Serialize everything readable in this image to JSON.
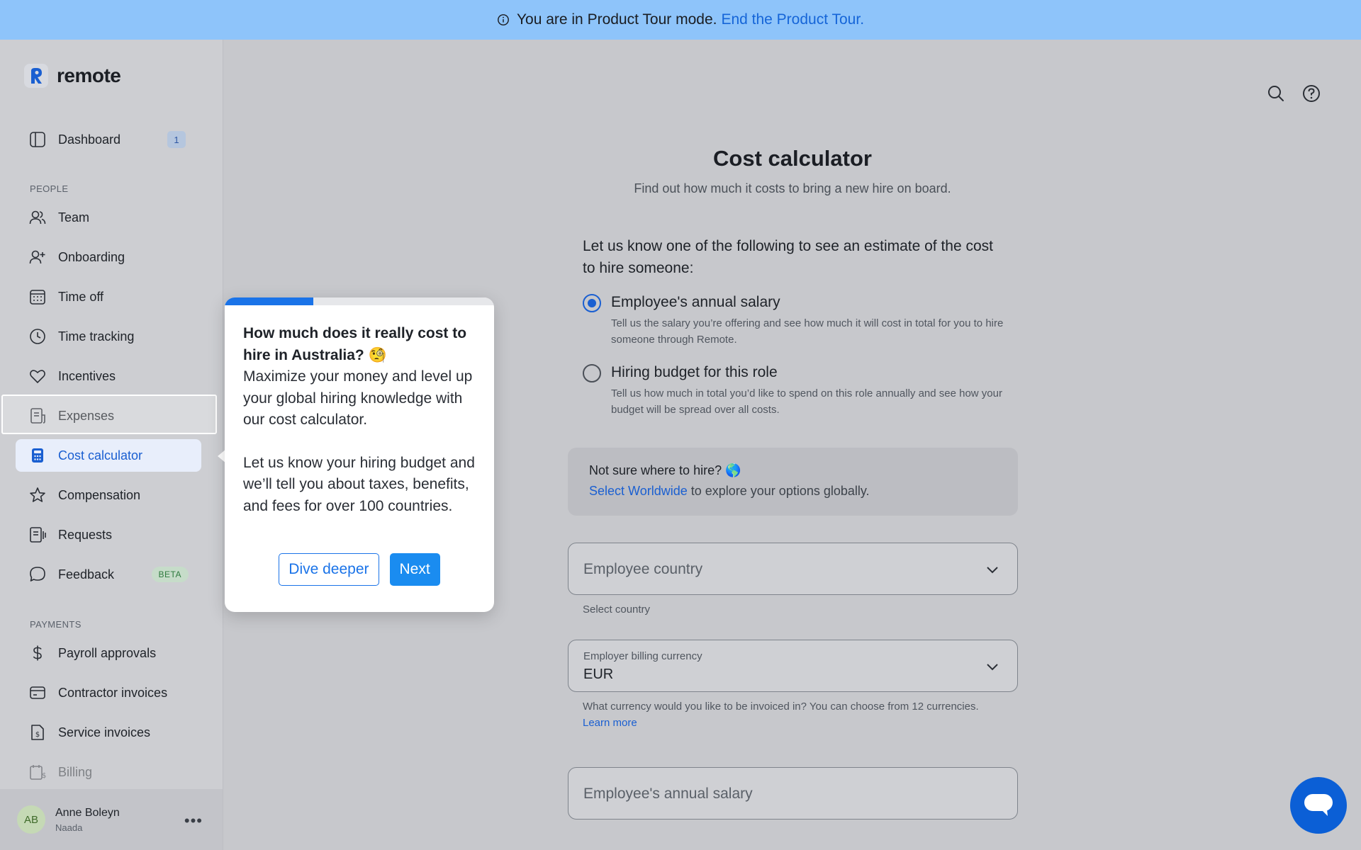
{
  "banner": {
    "text": "You are in Product Tour mode.",
    "link": "End the Product Tour."
  },
  "brand": {
    "name": "remote"
  },
  "sidebar": {
    "dashboard": {
      "label": "Dashboard",
      "badge": "1"
    },
    "people_label": "PEOPLE",
    "people": [
      {
        "label": "Team",
        "icon": "users-icon"
      },
      {
        "label": "Onboarding",
        "icon": "user-plus-icon"
      },
      {
        "label": "Time off",
        "icon": "calendar-icon"
      },
      {
        "label": "Time tracking",
        "icon": "clock-icon"
      },
      {
        "label": "Incentives",
        "icon": "heart-icon"
      },
      {
        "label": "Expenses",
        "icon": "receipt-icon"
      },
      {
        "label": "Cost calculator",
        "icon": "calculator-icon",
        "active": true
      },
      {
        "label": "Compensation",
        "icon": "star-icon"
      },
      {
        "label": "Requests",
        "icon": "requests-icon"
      },
      {
        "label": "Feedback",
        "icon": "chat-bubble-icon",
        "badge": "BETA"
      }
    ],
    "payments_label": "PAYMENTS",
    "payments": [
      {
        "label": "Payroll approvals",
        "icon": "dollar-icon"
      },
      {
        "label": "Contractor invoices",
        "icon": "card-icon"
      },
      {
        "label": "Service invoices",
        "icon": "invoice-icon"
      },
      {
        "label": "Billing",
        "icon": "billing-icon"
      }
    ],
    "user": {
      "initials": "AB",
      "name": "Anne Boleyn",
      "company": "Naada",
      "more": "•••"
    }
  },
  "main": {
    "title": "Cost calculator",
    "subtitle": "Find out how much it costs to bring a new hire on board.",
    "lead": "Let us know one of the following to see an estimate of the cost to hire someone:",
    "options": [
      {
        "title": "Employee's annual salary",
        "desc": "Tell us the salary you’re offering and see how much it will cost in total for you to hire someone through Remote.",
        "checked": true
      },
      {
        "title": "Hiring budget for this role",
        "desc": "Tell us how much in total you’d like to spend on this role annually and see how your budget will be spread over all costs.",
        "checked": false
      }
    ],
    "hint": {
      "title": "Not sure where to hire? 🌎",
      "link": "Select Worldwide",
      "rest": " to explore your options globally."
    },
    "country_field": {
      "placeholder": "Employee country",
      "helper": "Select country"
    },
    "currency_field": {
      "label": "Employer billing currency",
      "value": "EUR",
      "helper": "What currency would you like to be invoiced in? You can choose from 12 currencies.",
      "helper_link": "Learn more"
    },
    "salary_field": {
      "placeholder": "Employee's annual salary"
    }
  },
  "popover": {
    "progress": 0.33,
    "heading": "How much does it really cost to hire in Australia? 🧐",
    "para1": "Maximize your money and level up your global hiring knowledge with our cost calculator.",
    "para2": "Let us know your hiring budget and we’ll tell you about taxes, benefits, and fees for over 100 countries.",
    "secondary_button": "Dive deeper",
    "primary_button": "Next"
  },
  "colors": {
    "accent": "#1a5fd1",
    "banner": "#8ec4fa",
    "primary_button": "#1a8cf0",
    "chat": "#0b5fd6"
  }
}
